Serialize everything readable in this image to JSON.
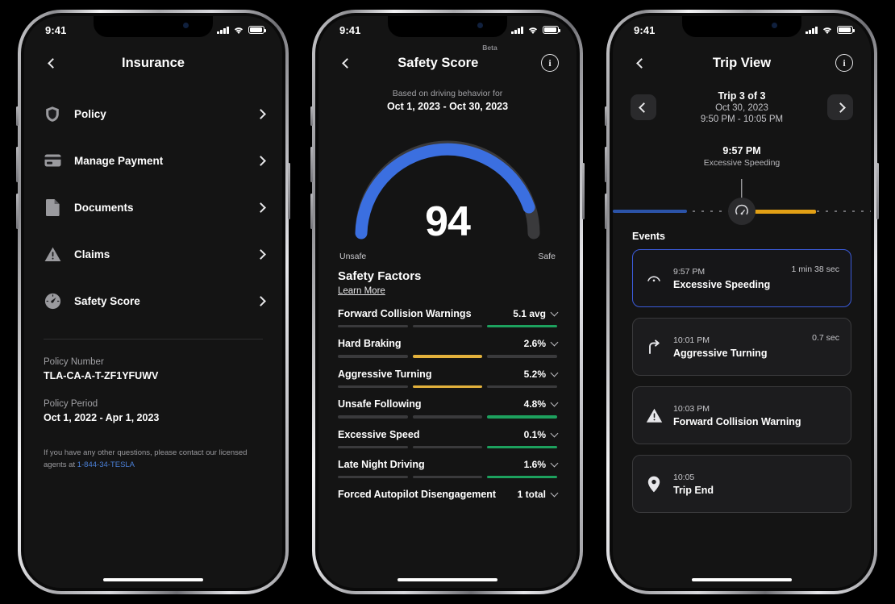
{
  "status_bar": {
    "time": "9:41",
    "signal_icon": "cellular-bars-icon",
    "wifi_icon": "wifi-icon",
    "battery_icon": "battery-icon"
  },
  "phone1": {
    "nav": {
      "title": "Insurance",
      "back_icon": "chevron-left-icon"
    },
    "menu": [
      {
        "label": "Policy",
        "icon": "shield-icon"
      },
      {
        "label": "Manage Payment",
        "icon": "credit-card-icon"
      },
      {
        "label": "Documents",
        "icon": "document-icon"
      },
      {
        "label": "Claims",
        "icon": "warning-triangle-icon"
      },
      {
        "label": "Safety Score",
        "icon": "speedometer-icon"
      }
    ],
    "policy_number_label": "Policy Number",
    "policy_number_value": "TLA-CA-A-T-ZF1YFUWV",
    "policy_period_label": "Policy Period",
    "policy_period_value": "Oct 1, 2022 - Apr 1, 2023",
    "legal_text": "If you have any other questions, please contact our licensed agents at ",
    "legal_phone": "1-844-34-TESLA",
    "link_color": "#4a7fd6"
  },
  "phone2": {
    "nav": {
      "title": "Safety Score",
      "beta": "Beta",
      "back_icon": "chevron-left-icon",
      "info_icon": "info-circle-icon"
    },
    "subtitle_1": "Based on driving behavior for",
    "subtitle_2": "Oct 1, 2023 - Oct 30, 2023",
    "gauge": {
      "value": "94",
      "label_left": "Unsafe",
      "label_right": "Safe",
      "arc_color": "#3b6fe0",
      "track_color": "#3a3a3c"
    },
    "factors_heading": "Safety Factors",
    "learn_more": "Learn More",
    "factors": [
      {
        "name": "Forward Collision Warnings",
        "value": "5.1 avg",
        "segment": 3,
        "color": "#1da15e"
      },
      {
        "name": "Hard Braking",
        "value": "2.6%",
        "segment": 2,
        "color": "#e2b13c"
      },
      {
        "name": "Aggressive Turning",
        "value": "5.2%",
        "segment": 2,
        "color": "#e2b13c"
      },
      {
        "name": "Unsafe Following",
        "value": "4.8%",
        "segment": 3,
        "color": "#1da15e"
      },
      {
        "name": "Excessive Speed",
        "value": "0.1%",
        "segment": 3,
        "color": "#1da15e"
      },
      {
        "name": "Late Night Driving",
        "value": "1.6%",
        "segment": 3,
        "color": "#1da15e"
      },
      {
        "name": "Forced Autopilot Disengagement",
        "value": "1 total",
        "segment": 0,
        "color": "#1da15e"
      }
    ]
  },
  "phone3": {
    "nav": {
      "title": "Trip View",
      "back_icon": "chevron-left-icon",
      "info_icon": "info-circle-icon"
    },
    "prev_icon": "chevron-left-icon",
    "next_icon": "chevron-right-icon",
    "trip_index": "Trip 3 of 3",
    "trip_date": "Oct 30, 2023",
    "trip_range": "9:50 PM - 10:05 PM",
    "timeline": {
      "marker_time": "9:57 PM",
      "marker_event": "Excessive Speeding",
      "knob_icon": "speedometer-icon",
      "blue_color": "#2b53a8",
      "orange_color": "#e2a015"
    },
    "events_heading": "Events",
    "events": [
      {
        "time": "9:57 PM",
        "name": "Excessive Speeding",
        "duration": "1 min 38 sec",
        "icon": "speedometer-icon",
        "selected": true
      },
      {
        "time": "10:01 PM",
        "name": "Aggressive Turning",
        "duration": "0.7 sec",
        "icon": "turn-arrow-icon",
        "selected": false
      },
      {
        "time": "10:03 PM",
        "name": "Forward Collision Warning",
        "duration": "",
        "icon": "warning-triangle-icon",
        "selected": false
      },
      {
        "time": "10:05",
        "name": "Trip End",
        "duration": "",
        "icon": "map-pin-icon",
        "selected": false
      }
    ],
    "selected_border_color": "#3b5bdb"
  }
}
